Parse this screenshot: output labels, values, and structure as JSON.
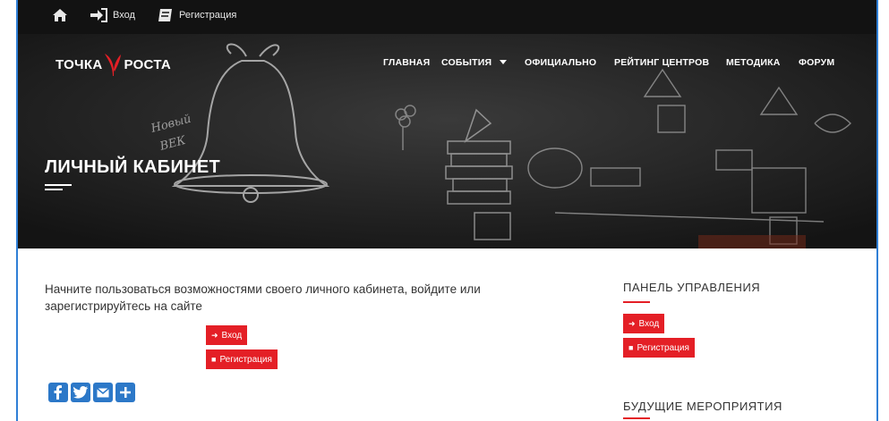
{
  "topbar": {
    "home_icon": "home-icon",
    "login_label": "Вход",
    "register_label": "Регистрация"
  },
  "brand": {
    "left": "ТОЧКА",
    "right": "РОСТА",
    "accent_color": "#e41f26"
  },
  "nav": {
    "items": [
      "ГЛАВНАЯ",
      "СОБЫТИЯ",
      "ОФИЦИАЛЬНО",
      "РЕЙТИНГ ЦЕНТРОВ",
      "МЕТОДИКА",
      "ФОРУМ"
    ]
  },
  "hero": {
    "title": "ЛИЧНЫЙ КАБИНЕТ",
    "chalk_text_1": "Новый",
    "chalk_text_2": "ВЕК"
  },
  "main": {
    "intro": "Начните пользоваться возможностями своего личного кабинета, войдите или зарегистрируйтесь на сайте",
    "login_button": "Вход",
    "register_button": "Регистрация"
  },
  "share_icons": [
    "facebook-icon",
    "twitter-icon",
    "email-icon",
    "plus-icon"
  ],
  "sidebar": {
    "panel_title": "ПАНЕЛЬ УПРАВЛЕНИЯ",
    "login_button": "Вход",
    "register_button": "Регистрация",
    "events_title": "БУДУЩИЕ МЕРОПРИЯТИЯ"
  }
}
